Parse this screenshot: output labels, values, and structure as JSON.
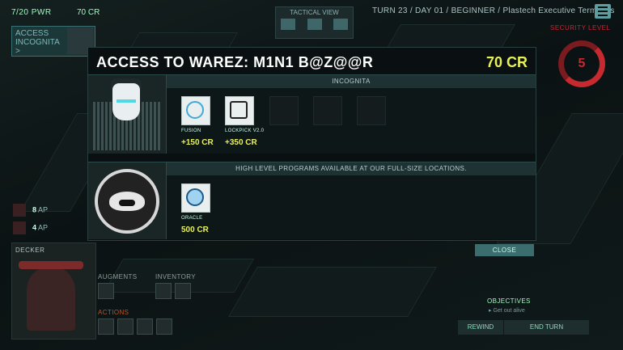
{
  "hud": {
    "power": "7/20 PWR",
    "credits": "70 CR",
    "turn_info": "TURN 23 / DAY 01 / BEGINNER / Plastech Executive Terminals",
    "tactical_view_label": "TACTICAL VIEW",
    "security_label": "SECURITY LEVEL",
    "security_value": "5",
    "access_panel": {
      "line1": "ACCESS",
      "line2": "INCOGNITA",
      "line3": ">"
    }
  },
  "modal": {
    "title": "ACCESS TO WAREZ: M1N1 B@Z@@R",
    "price": "70 CR",
    "section1": {
      "header": "INCOGNITA",
      "programs": [
        {
          "name": "FUSION",
          "price": "+150 CR",
          "icon": "fusion-icon"
        },
        {
          "name": "LOCKPICK V2.0",
          "price": "+350 CR",
          "icon": "lockpick-icon"
        }
      ]
    },
    "section2": {
      "header": "HIGH LEVEL PROGRAMS AVAILABLE AT OUR FULL-SIZE LOCATIONS.",
      "programs": [
        {
          "name": "ORACLE",
          "price": "500 CR",
          "icon": "oracle-icon"
        }
      ]
    },
    "close_label": "CLOSE"
  },
  "agents": [
    {
      "ap": "8",
      "unit": "AP"
    },
    {
      "ap": "4",
      "unit": "AP"
    }
  ],
  "panel": {
    "name": "DECKER",
    "augments_label": "AUGMENTS",
    "inventory_label": "INVENTORY",
    "actions_label": "ACTIONS"
  },
  "objectives": {
    "title": "OBJECTIVES",
    "item": "Get out alive"
  },
  "buttons": {
    "rewind": "REWIND",
    "end_turn": "END TURN"
  }
}
